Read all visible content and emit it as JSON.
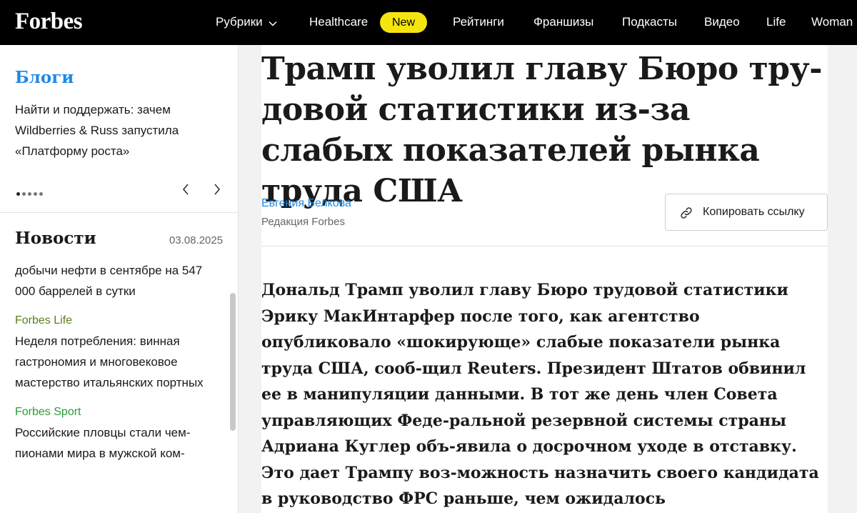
{
  "header": {
    "logo": "Forbes",
    "nav": {
      "rubrics": "Рубрики",
      "healthcare": "Healthcare",
      "new_badge": "New",
      "ratings": "Рейтинги",
      "franchises": "Франшизы",
      "podcasts": "Подкасты",
      "video": "Видео",
      "life": "Life",
      "woman": "Woman"
    },
    "badge_color": "#f5e50f"
  },
  "sidebar": {
    "blogs": {
      "title": "Блоги",
      "text": "Найти и поддержать: зачем Wildberries & Russ запустила «Платформу роста»",
      "dots_count": 5
    },
    "news": {
      "title": "Новости",
      "date": "03.08.2025",
      "items": [
        {
          "category": "",
          "text": "добычи нефти в сентябре на 547 000 баррелей в сутки"
        },
        {
          "category": "Forbes Life",
          "text": "Неделя потребления: винная гастрономия и многовековое мастерство итальянских портных"
        },
        {
          "category": "Forbes Sport",
          "text": "Российские пловцы стали чем-пионами мира в мужской ком-"
        }
      ]
    }
  },
  "article": {
    "headline": "Трамп уволил главу Бюро тру-довой статистики из-за слабых показателей рынка труда США",
    "author": "Евгения Белкова",
    "author_role": "Редакция Forbes",
    "copy_link": "Копировать ссылку",
    "lead": "Дональд Трамп уволил главу Бюро трудовой статистики Эрику МакИнтарфер после того, как агентство опубликовало «шокирующе» слабые показатели рынка труда США, сооб-щил Reuters. Президент Штатов обвинил ее в манипуляции данными. В тот же день член Совета управляющих Феде-ральной резервной системы страны Адриана Куглер объ-явила о досрочном уходе в отставку. Это дает Трампу воз-можность назначить своего кандидата в руководство ФРС раньше, чем ожидалось"
  },
  "colors": {
    "accent_blue": "#1e88e5",
    "life_green": "#5a7d1e",
    "sport_green": "#2e9a3a"
  }
}
